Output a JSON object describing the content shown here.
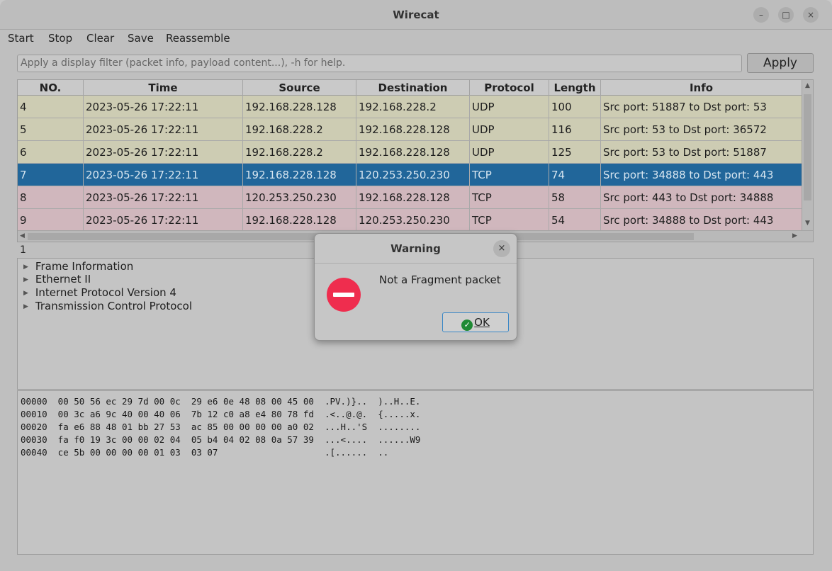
{
  "window": {
    "title": "Wirecat",
    "minimize": "–",
    "maximize": "□",
    "close": "×"
  },
  "menu": [
    "Start",
    "Stop",
    "Clear",
    "Save",
    "Reassemble"
  ],
  "filter": {
    "placeholder": "Apply a display filter (packet info, payload content...), -h for help.",
    "apply_label": "Apply"
  },
  "table": {
    "columns": [
      "NO.",
      "Time",
      "Source",
      "Destination",
      "Protocol",
      "Length",
      "Info"
    ],
    "rows": [
      {
        "cells": [
          "4",
          "2023-05-26 17:22:11",
          "192.168.228.128",
          "192.168.228.2",
          "UDP",
          "100",
          "Src port: 51887 to Dst port: 53"
        ],
        "color": "#cdccb3"
      },
      {
        "cells": [
          "5",
          "2023-05-26 17:22:11",
          "192.168.228.2",
          "192.168.228.128",
          "UDP",
          "116",
          "Src port: 53 to Dst port: 36572"
        ],
        "color": "#cdccb3"
      },
      {
        "cells": [
          "6",
          "2023-05-26 17:22:11",
          "192.168.228.2",
          "192.168.228.128",
          "UDP",
          "125",
          "Src port: 53 to Dst port: 51887"
        ],
        "color": "#cdccb3"
      },
      {
        "cells": [
          "7",
          "2023-05-26 17:22:11",
          "192.168.228.128",
          "120.253.250.230",
          "TCP",
          "74",
          "Src port: 34888 to Dst port: 443"
        ],
        "color": "#21669a",
        "selected": true
      },
      {
        "cells": [
          "8",
          "2023-05-26 17:22:11",
          "120.253.250.230",
          "192.168.228.128",
          "TCP",
          "58",
          "Src port: 443 to Dst port: 34888"
        ],
        "color": "#d0b7bd"
      },
      {
        "cells": [
          "9",
          "2023-05-26 17:22:11",
          "192.168.228.128",
          "120.253.250.230",
          "TCP",
          "54",
          "Src port: 34888 to Dst port: 443"
        ],
        "color": "#d0b7bd"
      }
    ]
  },
  "frame_count": "1",
  "tree": [
    "Frame Information",
    "Ethernet II",
    "Internet Protocol Version 4",
    "Transmission Control Protocol"
  ],
  "hex": [
    "00000  00 50 56 ec 29 7d 00 0c  29 e6 0e 48 08 00 45 00  .PV.)}..  )..H..E.",
    "00010  00 3c a6 9c 40 00 40 06  7b 12 c0 a8 e4 80 78 fd  .<..@.@.  {.....x.",
    "00020  fa e6 88 48 01 bb 27 53  ac 85 00 00 00 00 a0 02  ...H..'S  ........",
    "00030  fa f0 19 3c 00 00 02 04  05 b4 04 02 08 0a 57 39  ...<....  ......W9",
    "00040  ce 5b 00 00 00 00 01 03  03 07                    .[......  .."
  ],
  "dialog": {
    "title": "Warning",
    "message": "Not a Fragment packet",
    "ok_label": "OK",
    "close": "×",
    "ok_icon": "✓"
  }
}
